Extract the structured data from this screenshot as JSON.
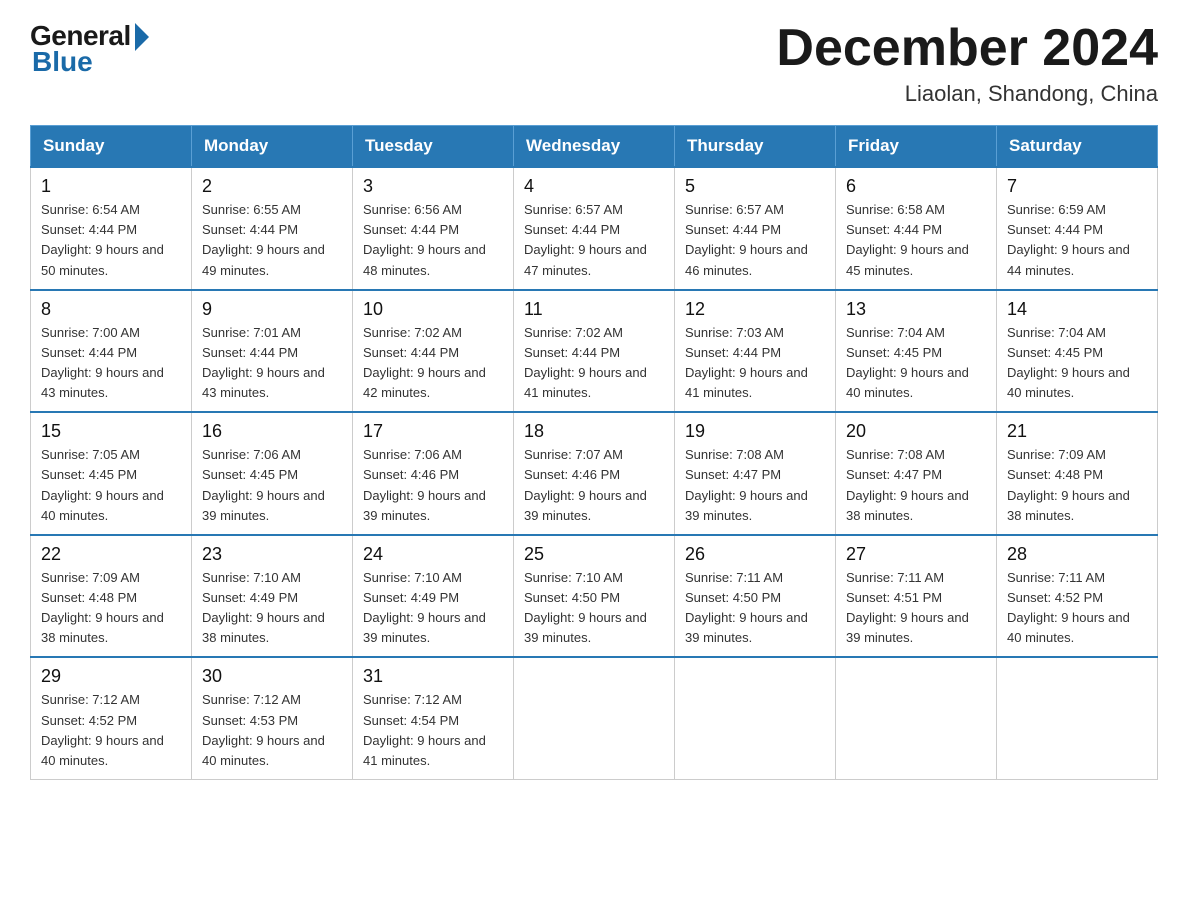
{
  "logo": {
    "general_text": "General",
    "blue_text": "Blue"
  },
  "title": "December 2024",
  "location": "Liaolan, Shandong, China",
  "header_days": [
    "Sunday",
    "Monday",
    "Tuesday",
    "Wednesday",
    "Thursday",
    "Friday",
    "Saturday"
  ],
  "weeks": [
    [
      {
        "day": "1",
        "sunrise": "6:54 AM",
        "sunset": "4:44 PM",
        "daylight": "9 hours and 50 minutes."
      },
      {
        "day": "2",
        "sunrise": "6:55 AM",
        "sunset": "4:44 PM",
        "daylight": "9 hours and 49 minutes."
      },
      {
        "day": "3",
        "sunrise": "6:56 AM",
        "sunset": "4:44 PM",
        "daylight": "9 hours and 48 minutes."
      },
      {
        "day": "4",
        "sunrise": "6:57 AM",
        "sunset": "4:44 PM",
        "daylight": "9 hours and 47 minutes."
      },
      {
        "day": "5",
        "sunrise": "6:57 AM",
        "sunset": "4:44 PM",
        "daylight": "9 hours and 46 minutes."
      },
      {
        "day": "6",
        "sunrise": "6:58 AM",
        "sunset": "4:44 PM",
        "daylight": "9 hours and 45 minutes."
      },
      {
        "day": "7",
        "sunrise": "6:59 AM",
        "sunset": "4:44 PM",
        "daylight": "9 hours and 44 minutes."
      }
    ],
    [
      {
        "day": "8",
        "sunrise": "7:00 AM",
        "sunset": "4:44 PM",
        "daylight": "9 hours and 43 minutes."
      },
      {
        "day": "9",
        "sunrise": "7:01 AM",
        "sunset": "4:44 PM",
        "daylight": "9 hours and 43 minutes."
      },
      {
        "day": "10",
        "sunrise": "7:02 AM",
        "sunset": "4:44 PM",
        "daylight": "9 hours and 42 minutes."
      },
      {
        "day": "11",
        "sunrise": "7:02 AM",
        "sunset": "4:44 PM",
        "daylight": "9 hours and 41 minutes."
      },
      {
        "day": "12",
        "sunrise": "7:03 AM",
        "sunset": "4:44 PM",
        "daylight": "9 hours and 41 minutes."
      },
      {
        "day": "13",
        "sunrise": "7:04 AM",
        "sunset": "4:45 PM",
        "daylight": "9 hours and 40 minutes."
      },
      {
        "day": "14",
        "sunrise": "7:04 AM",
        "sunset": "4:45 PM",
        "daylight": "9 hours and 40 minutes."
      }
    ],
    [
      {
        "day": "15",
        "sunrise": "7:05 AM",
        "sunset": "4:45 PM",
        "daylight": "9 hours and 40 minutes."
      },
      {
        "day": "16",
        "sunrise": "7:06 AM",
        "sunset": "4:45 PM",
        "daylight": "9 hours and 39 minutes."
      },
      {
        "day": "17",
        "sunrise": "7:06 AM",
        "sunset": "4:46 PM",
        "daylight": "9 hours and 39 minutes."
      },
      {
        "day": "18",
        "sunrise": "7:07 AM",
        "sunset": "4:46 PM",
        "daylight": "9 hours and 39 minutes."
      },
      {
        "day": "19",
        "sunrise": "7:08 AM",
        "sunset": "4:47 PM",
        "daylight": "9 hours and 39 minutes."
      },
      {
        "day": "20",
        "sunrise": "7:08 AM",
        "sunset": "4:47 PM",
        "daylight": "9 hours and 38 minutes."
      },
      {
        "day": "21",
        "sunrise": "7:09 AM",
        "sunset": "4:48 PM",
        "daylight": "9 hours and 38 minutes."
      }
    ],
    [
      {
        "day": "22",
        "sunrise": "7:09 AM",
        "sunset": "4:48 PM",
        "daylight": "9 hours and 38 minutes."
      },
      {
        "day": "23",
        "sunrise": "7:10 AM",
        "sunset": "4:49 PM",
        "daylight": "9 hours and 38 minutes."
      },
      {
        "day": "24",
        "sunrise": "7:10 AM",
        "sunset": "4:49 PM",
        "daylight": "9 hours and 39 minutes."
      },
      {
        "day": "25",
        "sunrise": "7:10 AM",
        "sunset": "4:50 PM",
        "daylight": "9 hours and 39 minutes."
      },
      {
        "day": "26",
        "sunrise": "7:11 AM",
        "sunset": "4:50 PM",
        "daylight": "9 hours and 39 minutes."
      },
      {
        "day": "27",
        "sunrise": "7:11 AM",
        "sunset": "4:51 PM",
        "daylight": "9 hours and 39 minutes."
      },
      {
        "day": "28",
        "sunrise": "7:11 AM",
        "sunset": "4:52 PM",
        "daylight": "9 hours and 40 minutes."
      }
    ],
    [
      {
        "day": "29",
        "sunrise": "7:12 AM",
        "sunset": "4:52 PM",
        "daylight": "9 hours and 40 minutes."
      },
      {
        "day": "30",
        "sunrise": "7:12 AM",
        "sunset": "4:53 PM",
        "daylight": "9 hours and 40 minutes."
      },
      {
        "day": "31",
        "sunrise": "7:12 AM",
        "sunset": "4:54 PM",
        "daylight": "9 hours and 41 minutes."
      },
      null,
      null,
      null,
      null
    ]
  ]
}
